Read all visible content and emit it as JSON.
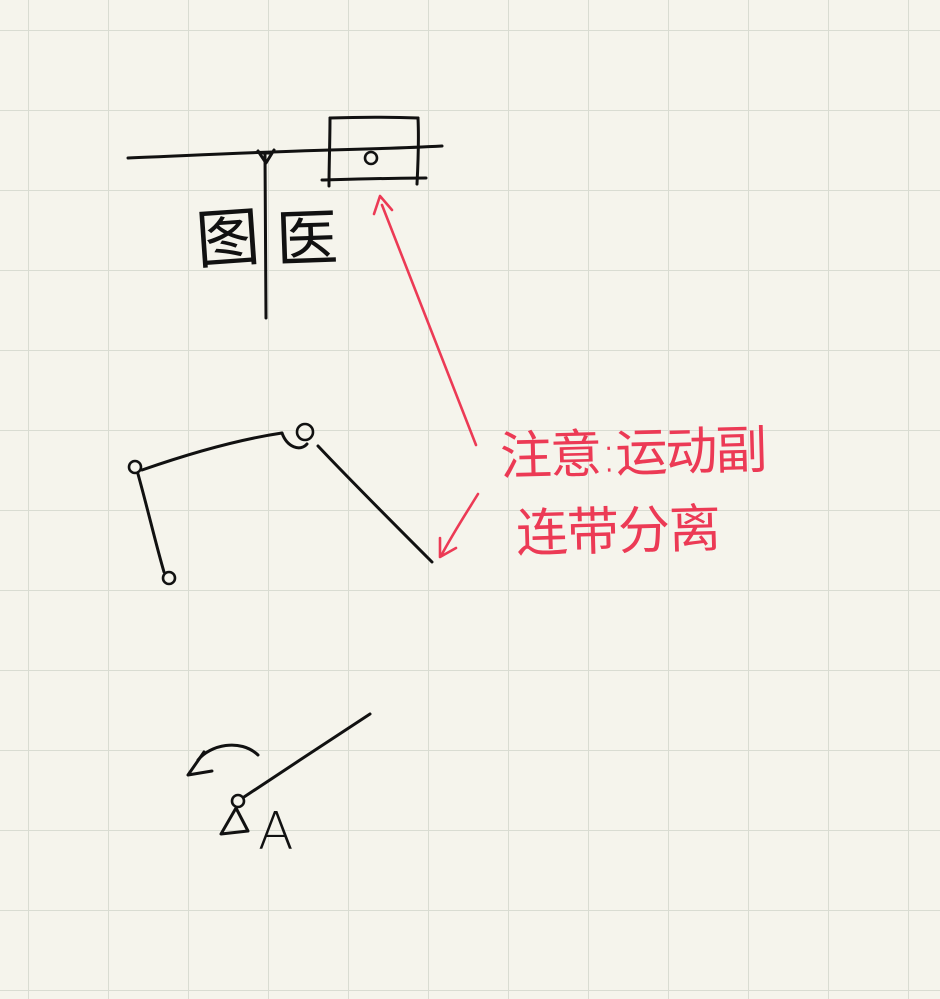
{
  "sketch": {
    "wall_label_left": "图",
    "wall_label_right": "医",
    "point_label": "A",
    "note": {
      "line_1": "注意:运动副",
      "line_2": "连带分离"
    }
  },
  "colors": {
    "background": "#f5f4ec",
    "grid": "#d9dcd2",
    "ink": "#111111",
    "annotation": "#ec3a55"
  }
}
